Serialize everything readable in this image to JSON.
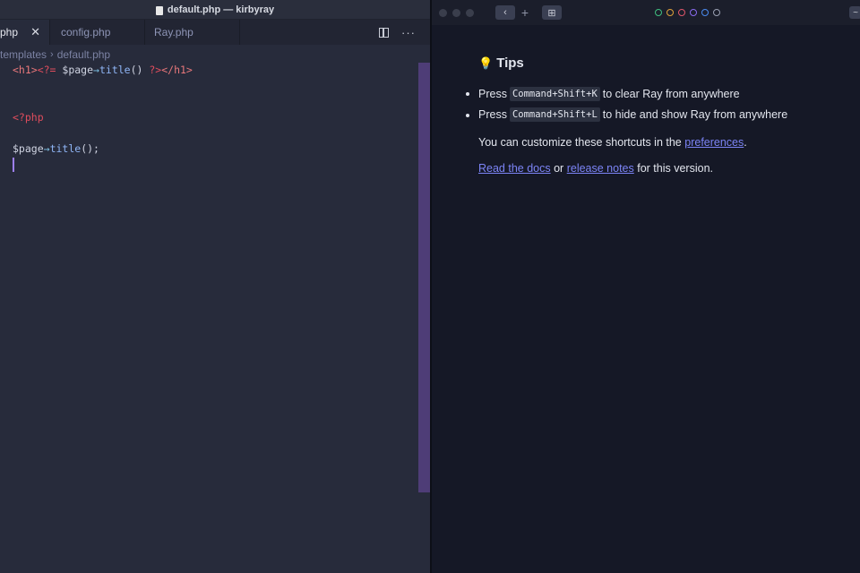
{
  "editor": {
    "window_title": "default.php — kirbyray",
    "tabs": [
      {
        "label": "php",
        "active": true
      },
      {
        "label": "config.php",
        "active": false
      },
      {
        "label": "Ray.php",
        "active": false
      }
    ],
    "close_glyph": "✕",
    "more_glyph": "···",
    "breadcrumb": {
      "folder": "templates",
      "separator": "›",
      "file": "default.php"
    },
    "code_line_1": {
      "t1": "<h1>",
      "t2": "<?=",
      "t3": " $page",
      "t4": "→",
      "t5": "title",
      "t6": "() ",
      "t7": "?>",
      "t8": "</h1>"
    },
    "code_line_4": "<?php",
    "code_line_6": {
      "var": "$page",
      "arrow": "→",
      "fn": "title",
      "rest": "();"
    }
  },
  "ray": {
    "toolbar": {
      "back_glyph": "‹",
      "add_glyph": "+",
      "screens_glyph": "⊞",
      "right_glyph": "~"
    },
    "color_filters": [
      "#3fbf7f",
      "#e0a23a",
      "#e0566a",
      "#8a6bf0",
      "#4a8bf0",
      "#9aa0b2"
    ],
    "tips": {
      "icon": "💡",
      "title": "Tips",
      "item1": {
        "before": "Press",
        "key": "Command+Shift+K",
        "after": "to clear Ray from anywhere"
      },
      "item2": {
        "before": "Press",
        "key": "Command+Shift+L",
        "after": "to hide and show Ray from anywhere"
      },
      "customize_before": "You can customize these shortcuts in the",
      "customize_link": "preferences",
      "customize_after": ".",
      "docs_link": "Read the docs",
      "docs_mid": "or",
      "notes_link": "release notes",
      "docs_after": "for this version."
    }
  }
}
